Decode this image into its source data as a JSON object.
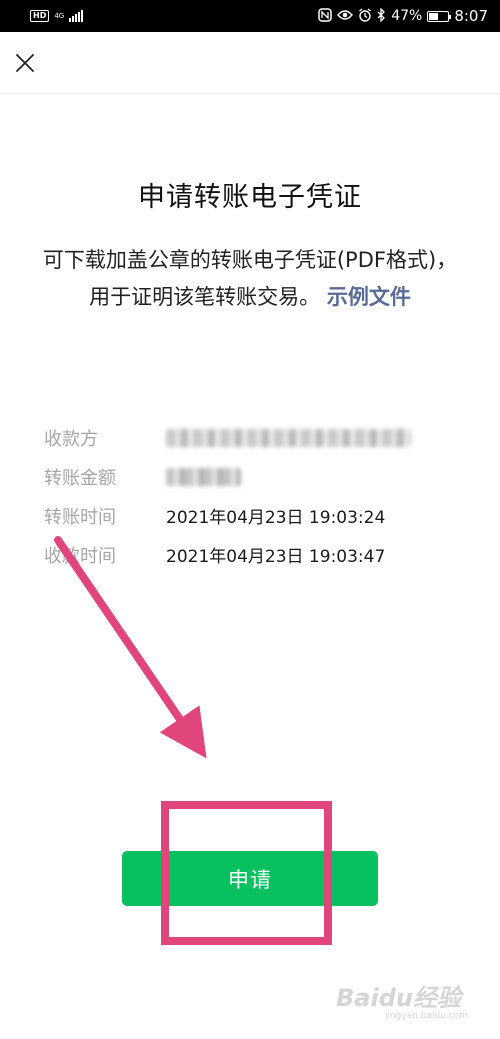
{
  "status_bar": {
    "hd_label": "HD",
    "network_label": "4G",
    "battery_percent": "47%",
    "battery_level": 0.47,
    "time": "8:07",
    "icons": [
      "hd-icon",
      "signal-icon",
      "nfc-icon",
      "eye-icon",
      "alarm-icon",
      "bluetooth-icon",
      "battery-icon"
    ]
  },
  "header": {
    "close_icon": "close-icon"
  },
  "page": {
    "title": "申请转账电子凭证",
    "description": "可下载加盖公章的转账电子凭证(PDF格式)，用于证明该笔转账交易。",
    "example_link": "示例文件"
  },
  "details": [
    {
      "label": "收款方",
      "value": ""
    },
    {
      "label": "转账金额",
      "value": ""
    },
    {
      "label": "转账时间",
      "value": "2021年04月23日 19:03:24"
    },
    {
      "label": "收款时间",
      "value": "2021年04月23日 19:03:47"
    }
  ],
  "actions": {
    "apply_label": "申请",
    "apply_color": "#07c160"
  },
  "colors": {
    "link": "#576b95",
    "annotation": "#e0457b"
  },
  "watermark": {
    "main": "Baidu经验",
    "sub": "jingyan.baidu.com"
  }
}
